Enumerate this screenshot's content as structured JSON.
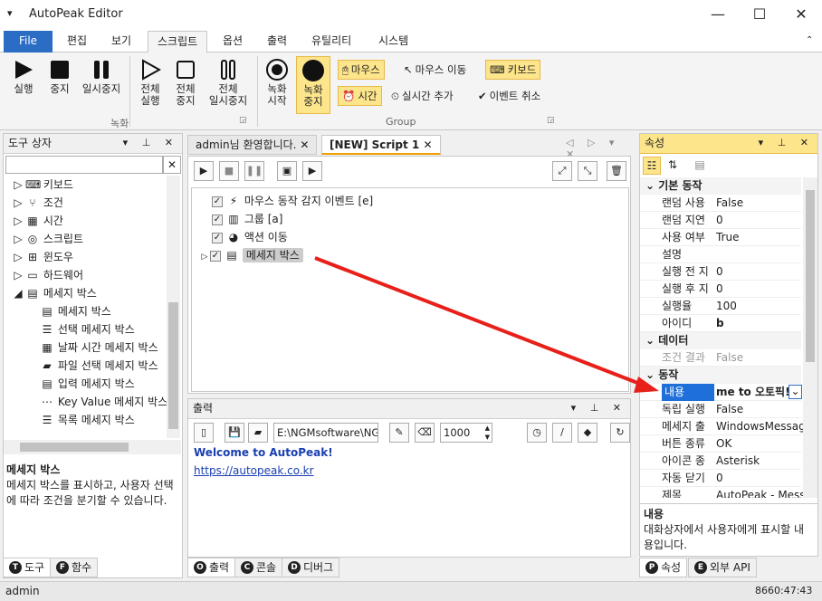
{
  "app": {
    "title": "AutoPeak Editor"
  },
  "ribbon_tabs": [
    "File",
    "편집",
    "보기",
    "스크립트",
    "옵션",
    "출력",
    "유틸리티",
    "시스템"
  ],
  "ribbon": {
    "btn_run": "실행",
    "btn_stop": "중지",
    "btn_pause": "일시중지",
    "btn_run_all_1": "전체",
    "btn_run_all_2": "실행",
    "btn_stop_all_1": "전체",
    "btn_stop_all_2": "중지",
    "btn_pause_all_1": "전체",
    "btn_pause_all_2": "일시중지",
    "group_record": "녹화",
    "btn_rec_start_1": "녹화",
    "btn_rec_start_2": "시작",
    "btn_rec_stop_1": "녹화",
    "btn_rec_stop_2": "중지",
    "btn_mouse": "마우스",
    "btn_mouse_move": "마우스 이동",
    "btn_keyboard": "키보드",
    "btn_time": "시간",
    "btn_realtime": "실시간 추가",
    "btn_event_cancel": "이벤트 취소",
    "group_group": "Group"
  },
  "toolbox": {
    "title": "도구 상자",
    "search_placeholder": "",
    "items": [
      "키보드",
      "조건",
      "시간",
      "스크립트",
      "윈도우",
      "하드웨어",
      "메세지 박스"
    ],
    "subitems": [
      "메세지 박스",
      "선택 메세지 박스",
      "날짜 시간 메세지 박스",
      "파일 선택 메세지 박스",
      "입력 메세지 박스",
      "Key Value 메세지 박스",
      "목록 메세지 박스"
    ],
    "desc_title": "메세지 박스",
    "desc_text": "메세지 박스를 표시하고, 사용자 선택에 따라 조건을 분기할 수 있습니다.",
    "tab_tools": "도구",
    "tab_functions": "함수"
  },
  "editor": {
    "tab1": "admin님 환영합니다.",
    "tab2": "[NEW] Script 1",
    "nodes": [
      "마우스 동작 감지 이벤트 [e]",
      "그룹 [a]",
      "액션 이동",
      "메세지 박스"
    ]
  },
  "output": {
    "title": "출력",
    "path": "E:\\NGMsoftware\\NG",
    "limit": "1000",
    "welcome": "Welcome to AutoPeak!",
    "link": "https://autopeak.co.kr",
    "tab_output": "출력",
    "tab_console": "콘솔",
    "tab_debug": "디버그"
  },
  "properties": {
    "title": "속성",
    "cat_basic": "기본 동작",
    "basic": [
      [
        "랜덤 사용",
        "False"
      ],
      [
        "랜덤 지연",
        "0"
      ],
      [
        "사용 여부",
        "True"
      ],
      [
        "설명",
        ""
      ],
      [
        "실행 전 지",
        "0"
      ],
      [
        "실행 후 지",
        "0"
      ],
      [
        "실행율",
        "100"
      ],
      [
        "아이디",
        "b"
      ]
    ],
    "cat_data": "데이터",
    "data": [
      [
        "조건 결과",
        "False"
      ]
    ],
    "cat_action": "동작",
    "action": [
      [
        "내용",
        "me to 오토픽!"
      ],
      [
        "독립 실행",
        "False"
      ],
      [
        "메세지 출",
        "WindowsMessage"
      ],
      [
        "버튼 종류",
        "OK"
      ],
      [
        "아이콘 종",
        "Asterisk"
      ],
      [
        "자동 닫기",
        "0"
      ],
      [
        "제목",
        "AutoPeak - Messa"
      ]
    ],
    "desc_title": "내용",
    "desc_text": "대화상자에서 사용자에게 표시할 내용입니다.",
    "tab_props": "속성",
    "tab_api": "외부 API"
  },
  "status": {
    "user": "admin",
    "time": "8660:47:43"
  }
}
